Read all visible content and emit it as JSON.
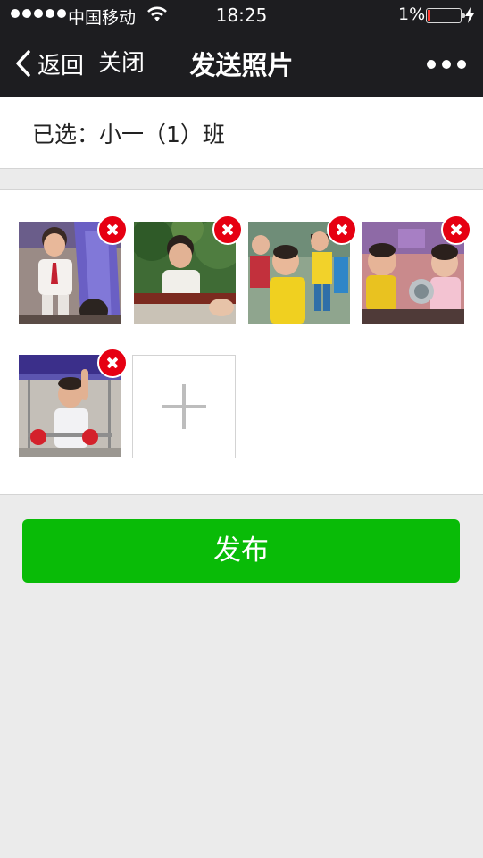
{
  "status_bar": {
    "carrier": "中国移动",
    "time": "18:25",
    "battery_percent": "1%",
    "battery_level": 0.01,
    "signal_icon": "signal-dots-icon",
    "wifi_icon": "wifi-icon",
    "charging_icon": "charging-bolt-icon"
  },
  "nav": {
    "back_label": "返回",
    "close_label": "关闭",
    "title": "发送照片",
    "more_icon": "more-dots-icon"
  },
  "selection": {
    "text": "已选：小一（1）班"
  },
  "photos": [
    {
      "name": "photo-1",
      "remove_icon": "remove-icon"
    },
    {
      "name": "photo-2",
      "remove_icon": "remove-icon"
    },
    {
      "name": "photo-3",
      "remove_icon": "remove-icon"
    },
    {
      "name": "photo-4",
      "remove_icon": "remove-icon"
    },
    {
      "name": "photo-5",
      "remove_icon": "remove-icon"
    }
  ],
  "add_photo_icon": "plus-icon",
  "publish_label": "发布",
  "colors": {
    "bar_bg": "#1d1d20",
    "accent_green": "#09bb07",
    "remove_red": "#e60012",
    "page_bg": "#ebebeb"
  }
}
